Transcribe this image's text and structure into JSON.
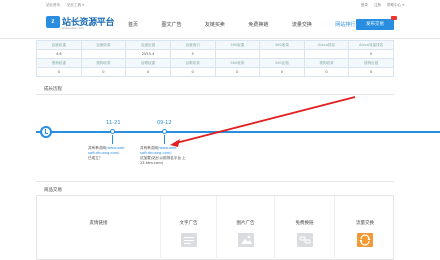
{
  "topbar": {
    "left": [
      "站长资讯",
      "站长工具 ▾"
    ],
    "right": [
      "登录",
      "注册",
      "帮助中心 ▾"
    ]
  },
  "logo": {
    "mark": "ZHANZHANG",
    "name": "站长资源平台",
    "url": "www.zzzz.com"
  },
  "nav": {
    "items": [
      "首页",
      "图文广告",
      "友链买卖",
      "免费换链",
      "流量交换",
      "网站排行"
    ],
    "cta": "发布交易",
    "cta_badge": "HOT"
  },
  "stats": {
    "row1_head": [
      "百度权重",
      "百度收录",
      "百度反链",
      "百度索引",
      "360权重",
      "360收录",
      "Alexa排名",
      "Alexa流量排名"
    ],
    "row1_vals": [
      "4.6",
      "",
      "2V55.4",
      "5",
      "",
      "",
      "",
      "0"
    ],
    "row2_head": [
      "搜狗权重",
      "搜狗收录",
      "谷歌权重",
      "谷歌收录",
      "360收录",
      "360反链",
      "搜狗收录",
      "搜狗反链"
    ],
    "row2_vals": [
      "0",
      "0",
      "0",
      "0",
      "0",
      "0",
      "0",
      "0"
    ]
  },
  "growth": {
    "title": "成长历程",
    "events": [
      {
        "date": "11-21",
        "text_a": "并有苇洪网",
        "text_b": "(www.web",
        "text_c": "sofluthuang.com)",
        "text_d": "已成立？"
      },
      {
        "date": "09-12",
        "text_a": "并有苇洪网",
        "text_b": "(www.web",
        "text_c": "sofluthuang.com)",
        "text_d": "试加载(站长以前排名平台 上23.htm.com)"
      }
    ]
  },
  "services": {
    "title": "商品交易",
    "items": [
      "友情链接",
      "文字广告",
      "图片广告",
      "免费换链",
      "流量交换"
    ]
  },
  "colors": {
    "accent": "#2a8ee0",
    "arrow": "#e02020",
    "orange": "#f39a36"
  }
}
